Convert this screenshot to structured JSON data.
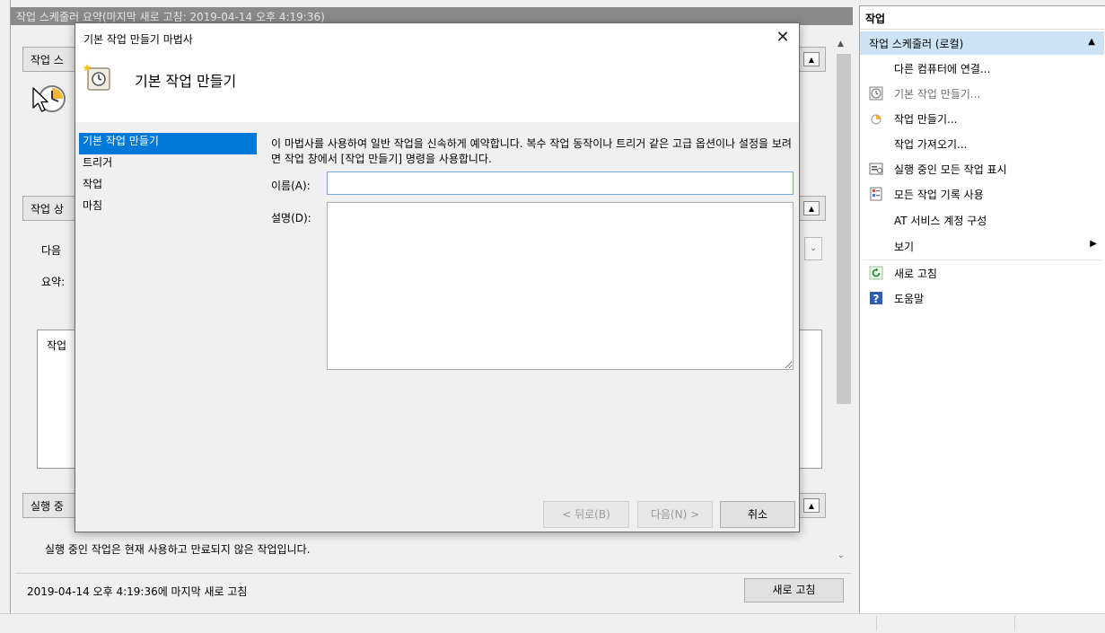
{
  "summary": {
    "header": "작업 스케줄러 요약(마지막 새로 고침: 2019-04-14 오후 4:19:36)",
    "section1_title": "작업 스",
    "section2_title": "작업 상",
    "next_label": "다음 ",
    "summary_label": "요약: ",
    "tasks_box_label": "작업 ",
    "section3_title": "실행 중",
    "running_note": "실행 중인 작업은 현재 사용하고 만료되지 않은 작업입니다.",
    "last_refresh": "2019-04-14 오후 4:19:36에 마지막 새로 고침",
    "refresh_button": "새로 고침"
  },
  "actions": {
    "title": "작업",
    "group": "작업 스케줄러 (로컬)",
    "items": [
      {
        "label": "다른 컴퓨터에 연결...",
        "icon": "none"
      },
      {
        "label": "기본 작업 만들기...",
        "icon": "clock-icon"
      },
      {
        "label": "작업 만들기...",
        "icon": "task-icon"
      },
      {
        "label": "작업 가져오기...",
        "icon": "none"
      },
      {
        "label": "실행 중인 모든 작업 표시",
        "icon": "list-icon"
      },
      {
        "label": "모든 작업 기록 사용",
        "icon": "log-icon"
      },
      {
        "label": "AT 서비스 계정 구성",
        "icon": "none"
      },
      {
        "label": "보기",
        "icon": "none"
      },
      {
        "label": "새로 고침",
        "icon": "refresh-icon"
      },
      {
        "label": "도움말",
        "icon": "help-icon"
      }
    ]
  },
  "wizard": {
    "title": "기본 작업 만들기 마법사",
    "heading": "기본 작업 만들기",
    "steps": [
      "기본 작업 만들기",
      "트리거",
      "작업",
      "마침"
    ],
    "intro": "이 마법사를 사용하여 일반 작업을 신속하게 예약합니다. 복수 작업 동작이나 트리거 같은 고급 옵션이나 설정을 보려면 작업 창에서 [작업 만들기] 명령을 사용합니다.",
    "name_label": "이름(A):",
    "name_value": "",
    "desc_label": "설명(D):",
    "desc_value": "",
    "back_button": "< 뒤로(B)",
    "next_button": "다음(N) >",
    "cancel_button": "취소"
  },
  "colors": {
    "selection": "#0078d7",
    "group_highlight": "#cde4f7"
  }
}
